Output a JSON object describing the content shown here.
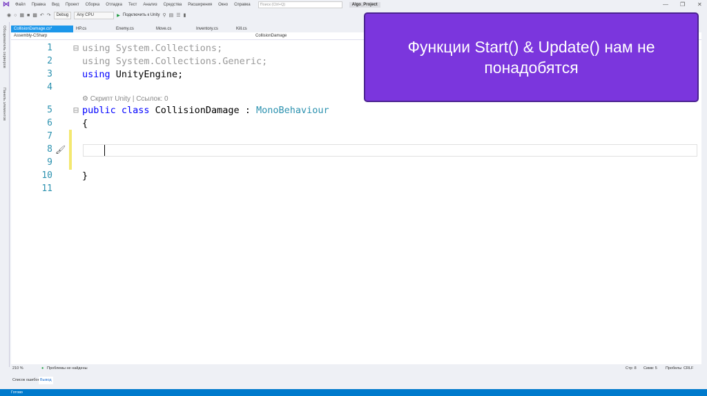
{
  "menu": [
    "Файл",
    "Правка",
    "Вид",
    "Проект",
    "Сборка",
    "Отладка",
    "Тест",
    "Анализ",
    "Средства",
    "Расширения",
    "Окно",
    "Справка"
  ],
  "search_placeholder": "Поиск (Ctrl+Q)",
  "project_name": "Algo_Project",
  "toolbar": {
    "config": "Debug",
    "platform": "Any CPU",
    "attach": "Подключить к Unity"
  },
  "sidebar": [
    "Обозреватель серверов",
    "Панель элементов"
  ],
  "tabs": [
    "CollisionDamage.cs*",
    "HP.cs",
    "Enemy.cs",
    "Move.cs",
    "Inventory.cs",
    "Kill.cs"
  ],
  "navbar": {
    "project": "Assembly-CSharp",
    "class": "CollisionDamage"
  },
  "code": {
    "l1": "using System.Collections;",
    "l2": "using System.Collections.Generic;",
    "l3a": "using",
    "l3b": " UnityEngine;",
    "lens": "Скрипт Unity | Ссылок: 0",
    "l5a": "public class ",
    "l5b": "CollisionDamage",
    "l5c": " : ",
    "l5d": "MonoBehaviour",
    "l6": "{",
    "l10": "}"
  },
  "line_numbers": [
    "1",
    "2",
    "3",
    "4",
    "5",
    "6",
    "7",
    "8",
    "9",
    "10",
    "11"
  ],
  "overlay_text": "Функции Start() & Update() нам не понадобятся",
  "status": {
    "zoom": "210 %",
    "problems": "Проблемы не найдены",
    "line": "Стр: 8",
    "col": "Симв: 5",
    "spaces": "Пробелы",
    "eol": "CRLF"
  },
  "output_tabs": [
    "Список ошибок",
    "Вывод"
  ],
  "ready": "Готово"
}
